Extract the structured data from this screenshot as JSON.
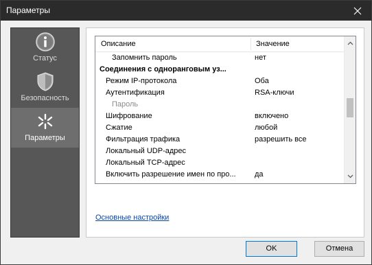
{
  "window": {
    "title": "Параметры"
  },
  "sidebar": {
    "items": [
      {
        "label": "Статус",
        "icon": "info-icon"
      },
      {
        "label": "Безопасность",
        "icon": "shield-icon"
      },
      {
        "label": "Параметры",
        "icon": "settings-spark-icon",
        "active": true
      }
    ]
  },
  "grid": {
    "col_description": "Описание",
    "col_value": "Значение",
    "rows": [
      {
        "name": "Запомнить пароль",
        "value": "нет"
      },
      {
        "name": "Соединения с одноранговым уз...",
        "value": ""
      },
      {
        "name": "Режим IP-протокола",
        "value": "Оба"
      },
      {
        "name": "Аутентификация",
        "value": "RSA-ключи"
      },
      {
        "name": "Пароль",
        "value": ""
      },
      {
        "name": "Шифрование",
        "value": "включено"
      },
      {
        "name": "Сжатие",
        "value": "любой"
      },
      {
        "name": "Фильтрация трафика",
        "value": "разрешить все"
      },
      {
        "name": "Локальный UDP-адрес",
        "value": ""
      },
      {
        "name": "Локальный TCP-адрес",
        "value": ""
      },
      {
        "name": "Включить разрешение имен по про...",
        "value": "да"
      }
    ]
  },
  "link": {
    "basic_settings": "Основные настройки"
  },
  "buttons": {
    "ok": "OK",
    "cancel": "Отмена"
  }
}
